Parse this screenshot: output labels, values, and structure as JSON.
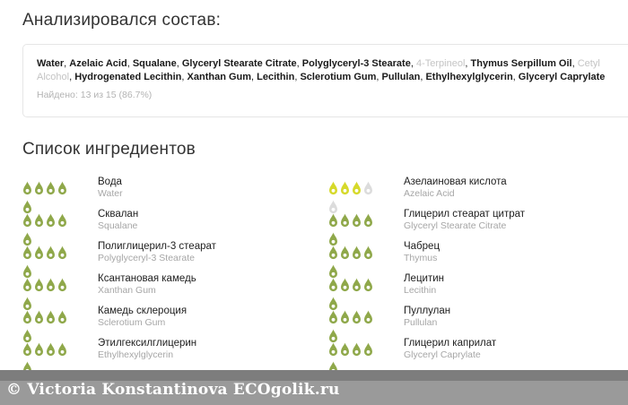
{
  "analysis": {
    "title": "Анализировался состав:",
    "ingredients": [
      {
        "text": "Water",
        "matched": true
      },
      {
        "text": "Azelaic Acid",
        "matched": true
      },
      {
        "text": "Squalane",
        "matched": true
      },
      {
        "text": "Glyceryl Stearate Citrate",
        "matched": true
      },
      {
        "text": "Polyglyceryl-3 Stearate",
        "matched": true
      },
      {
        "text": "4-Terpineol",
        "matched": false
      },
      {
        "text": "Thymus Serpillum Oil",
        "matched": true
      },
      {
        "text": "Cetyl Alcohol",
        "matched": false
      },
      {
        "text": "Hydrogenated Lecithin",
        "matched": true
      },
      {
        "text": "Xanthan Gum",
        "matched": true
      },
      {
        "text": "Lecithin",
        "matched": true
      },
      {
        "text": "Sclerotium Gum",
        "matched": true
      },
      {
        "text": "Pullulan",
        "matched": true
      },
      {
        "text": "Ethylhexylglycerin",
        "matched": true
      },
      {
        "text": "Glyceryl Caprylate",
        "matched": true
      }
    ],
    "found_text": "Найдено: 13 из 15 (86.7%)"
  },
  "list": {
    "title": "Список ингредиентов",
    "colors": {
      "good": "#8fa84a",
      "moderate": "#d6d92a",
      "empty": "#dcdcdc"
    },
    "items": [
      {
        "name_ru": "Вода",
        "name_lat": "Water",
        "rating": 5,
        "level": "good"
      },
      {
        "name_ru": "Азелаиновая кислота",
        "name_lat": "Azelaic Acid",
        "rating": 3,
        "level": "moderate"
      },
      {
        "name_ru": "Сквалан",
        "name_lat": "Squalane",
        "rating": 5,
        "level": "good"
      },
      {
        "name_ru": "Глицерил стеарат цитрат",
        "name_lat": "Glyceryl Stearate Citrate",
        "rating": 5,
        "level": "good"
      },
      {
        "name_ru": "Полиглицерил-3 стеарат",
        "name_lat": "Polyglyceryl-3 Stearate",
        "rating": 5,
        "level": "good"
      },
      {
        "name_ru": "Чабрец",
        "name_lat": "Thymus",
        "rating": 5,
        "level": "good"
      },
      {
        "name_ru": "Ксантановая камедь",
        "name_lat": "Xanthan Gum",
        "rating": 5,
        "level": "good"
      },
      {
        "name_ru": "Лецитин",
        "name_lat": "Lecithin",
        "rating": 5,
        "level": "good"
      },
      {
        "name_ru": "Камедь склероция",
        "name_lat": "Sclerotium Gum",
        "rating": 5,
        "level": "good"
      },
      {
        "name_ru": "Пуллулан",
        "name_lat": "Pullulan",
        "rating": 5,
        "level": "good"
      },
      {
        "name_ru": "Этилгексилглицерин",
        "name_lat": "Ethylhexylglycerin",
        "rating": 5,
        "level": "good"
      },
      {
        "name_ru": "Глицерил каприлат",
        "name_lat": "Glyceryl Caprylate",
        "rating": 5,
        "level": "good"
      }
    ]
  },
  "watermark": "© Victoria Konstantinova ECOgolik.ru"
}
